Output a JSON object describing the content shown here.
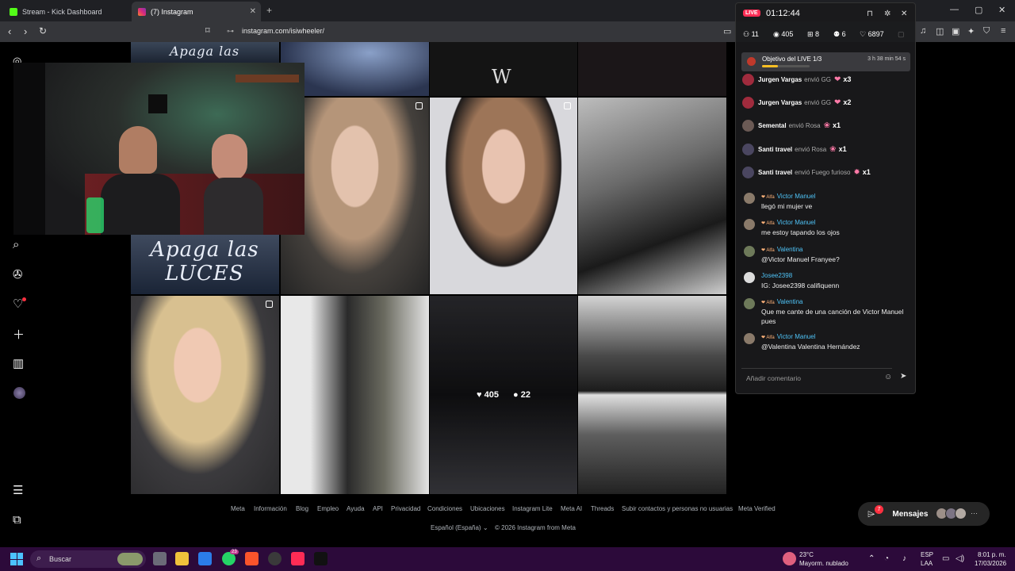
{
  "browser": {
    "tabs": [
      {
        "title": "Stream - Kick Dashboard",
        "active": false
      },
      {
        "title": "(7) Instagram",
        "active": true
      }
    ],
    "url": "instagram.com/isiwheeler/"
  },
  "grid": {
    "title_art": "Apaga las LUCES",
    "title_art_top": "Apaga las",
    "w_logo": "W",
    "hover_likes": "405",
    "hover_comments": "22"
  },
  "footer": {
    "links": [
      "Meta",
      "Información",
      "Blog",
      "Empleo",
      "Ayuda",
      "API",
      "Privacidad",
      "Condiciones",
      "Ubicaciones",
      "Instagram Lite",
      "Meta AI",
      "Threads",
      "Subir contactos y personas no usuarias",
      "Meta Verified"
    ],
    "language": "Español (España)",
    "copyright": "© 2026 Instagram from Meta"
  },
  "messages_pill": {
    "label": "Mensajes",
    "badge": "7"
  },
  "live": {
    "badge": "LIVE",
    "elapsed": "01:12:44",
    "stats": {
      "viewers_a": "11",
      "views": "405",
      "gifts": "8",
      "users": "6",
      "likes": "6897"
    },
    "goal": {
      "label": "Objetivo del LIVE 1/3",
      "time_left": "3 h 38 min 54 s",
      "progress": 0.33
    },
    "gifts": [
      {
        "user": "Jurgen Vargas",
        "action": "envió GG",
        "count": "x3"
      },
      {
        "user": "Jurgen Vargas",
        "action": "envió GG",
        "count": "x2"
      },
      {
        "user": "Semental",
        "action": "envió Rosa",
        "count": "x1"
      },
      {
        "user": "Santi travel",
        "action": "envió Rosa",
        "count": "x1"
      },
      {
        "user": "Santi travel",
        "action": "envió Fuego furioso",
        "count": "x1"
      }
    ],
    "chat": [
      {
        "tag": "Alfa",
        "name": "Victor Manuel",
        "text": "llegó mi mujer ve"
      },
      {
        "tag": "Alfa",
        "name": "Victor Manuel",
        "text": "me estoy tapando los ojos"
      },
      {
        "tag": "Alfa",
        "name": "Valentina",
        "text": "@Victor Manuel Franyee?"
      },
      {
        "tag": "",
        "name": "Josee2398",
        "text": "IG: Josee2398 califiquenn"
      },
      {
        "tag": "Alfa",
        "name": "Valentina",
        "text": "Que me cante de una canción de Victor Manuel pues"
      },
      {
        "tag": "Alfa",
        "name": "Victor Manuel",
        "text": "@Valentina Valentina Hernández"
      }
    ],
    "comment_placeholder": "Añadir comentario"
  },
  "taskbar": {
    "search": "Buscar",
    "weather_temp": "23°C",
    "weather_desc": "Mayorm. nublado",
    "lang_top": "ESP",
    "lang_bottom": "LAA",
    "time": "8:01 p. m.",
    "date": "17/03/2026",
    "whatsapp_badge": "23"
  }
}
